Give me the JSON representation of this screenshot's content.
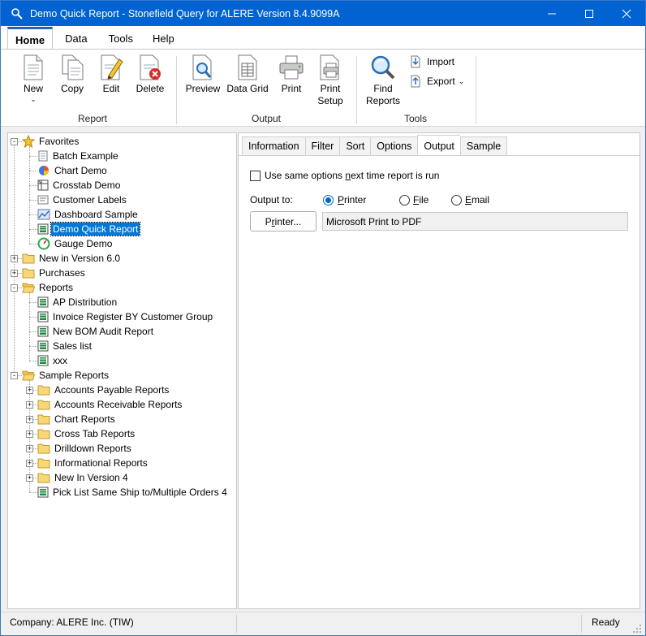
{
  "window": {
    "title": "Demo Quick Report - Stonefield Query for ALERE Version 8.4.9099A",
    "minimize_icon": "minimize-icon",
    "maximize_icon": "maximize-icon",
    "close_icon": "close-icon"
  },
  "menu": {
    "tabs": [
      {
        "label": "Home"
      },
      {
        "label": "Data"
      },
      {
        "label": "Tools"
      },
      {
        "label": "Help"
      }
    ]
  },
  "ribbon": {
    "report_group": {
      "label": "Report",
      "new": "New",
      "copy": "Copy",
      "edit": "Edit",
      "delete": "Delete"
    },
    "output_group": {
      "label": "Output",
      "preview": "Preview",
      "data_grid": "Data Grid",
      "print": "Print",
      "print_setup_1": "Print",
      "print_setup_2": "Setup"
    },
    "tools_group": {
      "label": "Tools",
      "find_1": "Find",
      "find_2": "Reports",
      "import": "Import",
      "export": "Export"
    }
  },
  "tree": {
    "favorites": "Favorites",
    "fav_items": [
      "Batch Example",
      "Chart Demo",
      "Crosstab Demo",
      "Customer Labels",
      "Dashboard Sample",
      "Demo Quick Report",
      "Gauge Demo"
    ],
    "new_in_v6": "New in Version 6.0",
    "purchases": "Purchases",
    "reports": "Reports",
    "report_items": [
      "AP Distribution",
      "Invoice Register BY Customer Group",
      "New BOM Audit Report",
      "Sales list",
      "xxx"
    ],
    "sample_reports": "Sample Reports",
    "sample_folders": [
      "Accounts Payable Reports",
      "Accounts Receivable Reports",
      "Chart Reports",
      "Cross Tab Reports",
      "Drilldown Reports",
      "Informational Reports",
      "New In Version 4"
    ],
    "sample_last": "Pick List Same Ship to/Multiple Orders 4"
  },
  "tabs": [
    "Information",
    "Filter",
    "Sort",
    "Options",
    "Output",
    "Sample"
  ],
  "output": {
    "same_options_pre": "Use same options ",
    "same_options_u": "n",
    "same_options_post": "ext time report is run",
    "output_to": "Output to:",
    "printer_u": "P",
    "printer_rest": "rinter",
    "file_u": "F",
    "file_rest": "ile",
    "email_u": "E",
    "email_rest": "mail",
    "printer_btn_pre": "P",
    "printer_btn_u": "r",
    "printer_btn_post": "inter...",
    "printer_name": "Microsoft Print to PDF"
  },
  "status": {
    "company": "Company: ALERE Inc. (TIW)",
    "state": "Ready"
  }
}
